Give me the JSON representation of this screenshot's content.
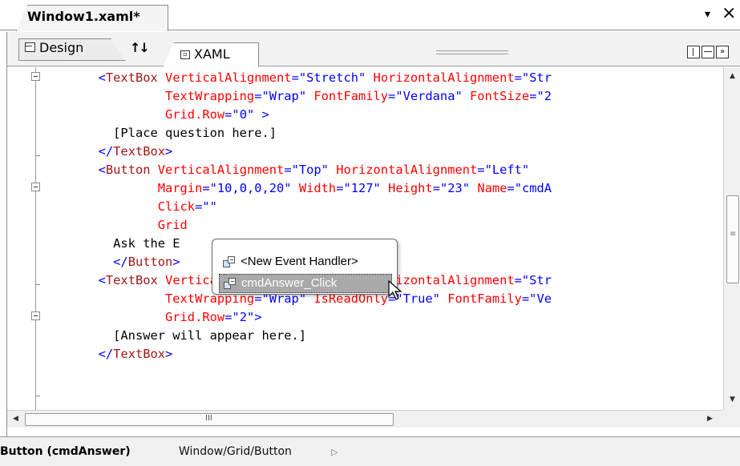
{
  "document_tab": {
    "title": "Window1.xaml*",
    "menu_glyph": "▾",
    "close_glyph": "×"
  },
  "pane_tabs": {
    "design_label": "Design",
    "swap_glyph": "↑↓",
    "xaml_label": "XAML",
    "view_buttons": [
      "vertical-split",
      "horizontal-split",
      "collapse"
    ]
  },
  "code": {
    "lines": [
      "      <TextBox VerticalAlignment=\"Stretch\" HorizontalAlignment=\"Str",
      "               TextWrapping=\"Wrap\" FontFamily=\"Verdana\" FontSize=\"2",
      "               Grid.Row=\"0\" >",
      "        [Place question here.]",
      "      </TextBox>",
      "      <Button VerticalAlignment=\"Top\" HorizontalAlignment=\"Left\"",
      "              Margin=\"10,0,0,20\" Width=\"127\" Height=\"23\" Name=\"cmdA",
      "              Click=\"\"",
      "              Grid",
      "        Ask the E",
      "        </Button>",
      "      <TextBox VerticalAlignment=\"Stretch\" HorizontalAlignment=\"Str",
      "               TextWrapping=\"Wrap\" IsReadOnly=\"True\" FontFamily=\"Ve",
      "               Grid.Row=\"2\">",
      "        [Answer will appear here.]",
      "      </TextBox>"
    ],
    "colors": {
      "tag": "#a31515",
      "attribute": "#ff0000",
      "value": "#0000ff",
      "punct": "#0000ff",
      "text": "#000000"
    }
  },
  "intellisense": {
    "items": [
      "<New Event Handler>",
      "cmdAnswer_Click"
    ],
    "selected_index": 1
  },
  "hscroll": {
    "grip_label": "III"
  },
  "status": {
    "selected_element": "Button (cmdAnswer)",
    "path": "Window/Grid/Button"
  }
}
